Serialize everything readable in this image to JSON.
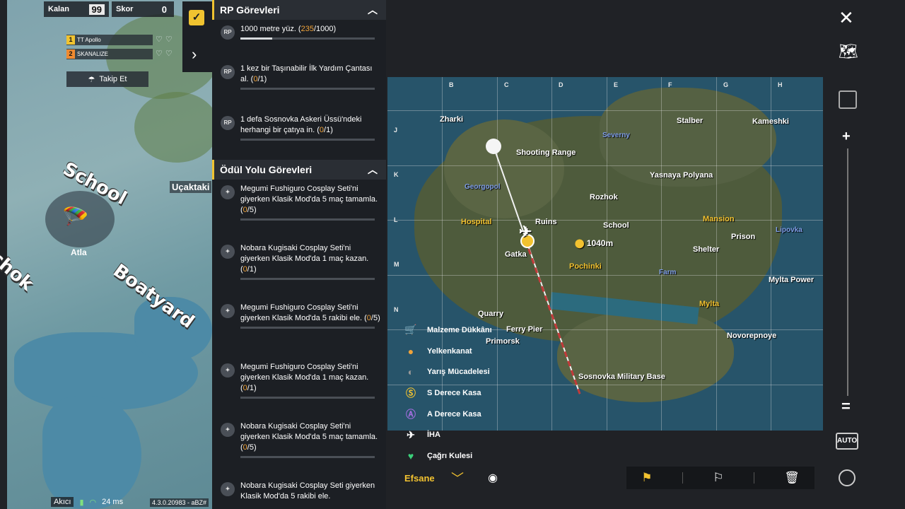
{
  "hud": {
    "remaining_label": "Kalan",
    "remaining_value": "99",
    "score_label": "Skor",
    "score_value": "0",
    "team": [
      {
        "index": "1",
        "name": "TT Apollo",
        "color": "#f0c330"
      },
      {
        "index": "2",
        "name": "SKANALIZE",
        "color": "#f08a30"
      }
    ],
    "follow_label": "Takip Et",
    "jump_label": "Atla",
    "plane_label": "Uçaktaki",
    "status": {
      "quality": "Akıcı",
      "ping": "24 ms",
      "version": "4.3.0.20983 - aBZ#"
    }
  },
  "world_labels": [
    "School",
    "Boatyard",
    "chok"
  ],
  "tasks": {
    "rp_title": "RP Görevleri",
    "rp_items": [
      {
        "icon": "RP",
        "pre": "1000 metre yüz. (",
        "count": "235",
        "post": "/1000)",
        "progress": 0.235
      },
      {
        "icon": "RP",
        "pre": "1 kez bir Taşınabilir İlk Yardım Çantası al. (",
        "count": "0",
        "post": "/1)"
      },
      {
        "icon": "RP",
        "pre": "1 defa Sosnovka Askeri Üssü'ndeki herhangi bir çatıya in. (",
        "count": "0",
        "post": "/1)"
      }
    ],
    "reward_title": "Ödül Yolu Görevleri",
    "reward_items": [
      {
        "pre": "Megumi Fushiguro Cosplay Seti'ni giyerken Klasik Mod'da 5 maç tamamla. (",
        "count": "0",
        "post": "/5)"
      },
      {
        "pre": "Nobara Kugisaki Cosplay Seti'ni giyerken Klasik Mod'da 1 maç kazan. (",
        "count": "0",
        "post": "/1)"
      },
      {
        "pre": "Megumi Fushiguro Cosplay Seti'ni giyerken Klasik Mod'da 5 rakibi ele. (",
        "count": "0",
        "post": "/5)"
      },
      {
        "pre": "Megumi Fushiguro Cosplay Seti'ni giyerken Klasik Mod'da 1 maç kazan. (",
        "count": "0",
        "post": "/1)"
      },
      {
        "pre": "Nobara Kugisaki Cosplay Seti'ni giyerken Klasik Mod'da 5 maç tamamla. (",
        "count": "0",
        "post": "/5)"
      },
      {
        "pre": "Nobara Kugisaki Cosplay Seti giyerken Klasik Mod'da 5 rakibi ele.",
        "count": "",
        "post": ""
      }
    ]
  },
  "map": {
    "columns": [
      "B",
      "C",
      "D",
      "E",
      "F",
      "G",
      "H"
    ],
    "rows": [
      "J",
      "K",
      "L",
      "M",
      "N"
    ],
    "distance": "1040m",
    "places": [
      {
        "name": "Zharki",
        "style": "white"
      },
      {
        "name": "Shooting Range",
        "style": "white"
      },
      {
        "name": "Severny",
        "style": "blue"
      },
      {
        "name": "Stalber",
        "style": "white"
      },
      {
        "name": "Kameshki",
        "style": "white"
      },
      {
        "name": "Georgopol",
        "style": "blue"
      },
      {
        "name": "Yasnaya Polyana",
        "style": "white"
      },
      {
        "name": "Rozhok",
        "style": "white"
      },
      {
        "name": "Hospital",
        "style": "gold"
      },
      {
        "name": "Ruins",
        "style": "white"
      },
      {
        "name": "School",
        "style": "white"
      },
      {
        "name": "Mansion",
        "style": "gold"
      },
      {
        "name": "Lipovka",
        "style": "blue"
      },
      {
        "name": "Prison",
        "style": "white"
      },
      {
        "name": "Gatka",
        "style": "white"
      },
      {
        "name": "Pochinki",
        "style": "gold"
      },
      {
        "name": "Shelter",
        "style": "white"
      },
      {
        "name": "Farm",
        "style": "blue"
      },
      {
        "name": "Mylta Power",
        "style": "white"
      },
      {
        "name": "Mylta",
        "style": "gold"
      },
      {
        "name": "Quarry",
        "style": "white"
      },
      {
        "name": "Ferry Pier",
        "style": "white"
      },
      {
        "name": "Primorsk",
        "style": "white"
      },
      {
        "name": "Novorepnoye",
        "style": "white"
      },
      {
        "name": "Sosnovka Military Base",
        "style": "white"
      }
    ],
    "legend": [
      {
        "icon": "cart-icon",
        "label": "Malzeme Dükkânı"
      },
      {
        "icon": "glider-icon",
        "label": "Yelkenkanat"
      },
      {
        "icon": "race-icon",
        "label": "Yarış Mücadelesi"
      },
      {
        "icon": "s-crate-icon",
        "label": "S Derece Kasa"
      },
      {
        "icon": "a-crate-icon",
        "label": "A Derece Kasa"
      },
      {
        "icon": "drone-icon",
        "label": "İHA"
      },
      {
        "icon": "tower-icon",
        "label": "Çağrı Kulesi"
      }
    ],
    "filter_label": "Efsane"
  },
  "colors": {
    "accent": "#f2c230",
    "panel": "#1c1f24",
    "water": "#27546a"
  }
}
